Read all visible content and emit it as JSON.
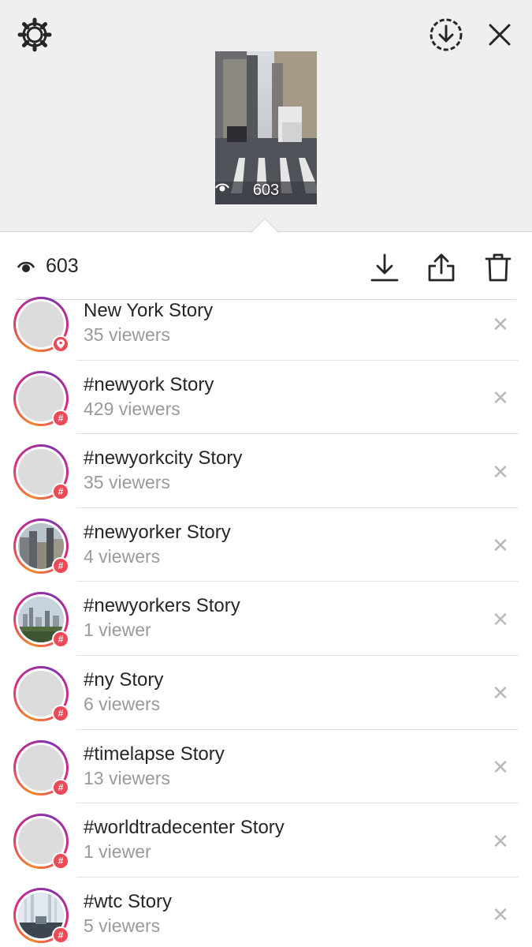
{
  "header": {
    "settings_icon": "gear-icon",
    "download_icon": "circle-download-icon",
    "close_icon": "close-icon",
    "thumbnail_views": "603"
  },
  "stats": {
    "views": "603",
    "actions": [
      "save-icon",
      "share-icon",
      "trash-icon"
    ]
  },
  "stories": [
    {
      "title": "New York Story",
      "viewers": "35 viewers",
      "badge": "location",
      "avatar": "placeholder"
    },
    {
      "title": "#newyork Story",
      "viewers": "429 viewers",
      "badge": "hashtag",
      "avatar": "placeholder"
    },
    {
      "title": "#newyorkcity Story",
      "viewers": "35 viewers",
      "badge": "hashtag",
      "avatar": "placeholder"
    },
    {
      "title": "#newyorker Story",
      "viewers": "4 viewers",
      "badge": "hashtag",
      "avatar": "city-photo"
    },
    {
      "title": "#newyorkers Story",
      "viewers": "1 viewer",
      "badge": "hashtag",
      "avatar": "skyline-photo"
    },
    {
      "title": "#ny Story",
      "viewers": "6 viewers",
      "badge": "hashtag",
      "avatar": "placeholder"
    },
    {
      "title": "#timelapse Story",
      "viewers": "13 viewers",
      "badge": "hashtag",
      "avatar": "placeholder"
    },
    {
      "title": "#worldtradecenter Story",
      "viewers": "1 viewer",
      "badge": "hashtag",
      "avatar": "placeholder"
    },
    {
      "title": "#wtc Story",
      "viewers": "5 viewers",
      "badge": "hashtag",
      "avatar": "memorial-photo"
    }
  ],
  "colors": {
    "badge": "#ed4956",
    "ring_start": "#f58529",
    "ring_end": "#8134af",
    "muted_text": "#9a9a9a"
  }
}
